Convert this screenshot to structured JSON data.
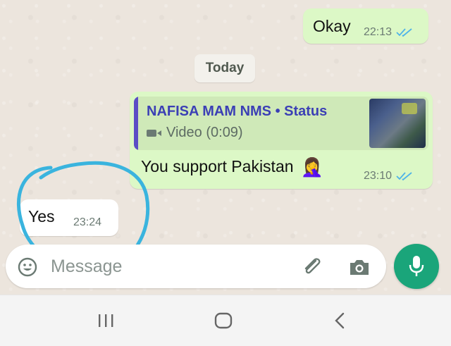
{
  "messages": [
    {
      "id": "okay",
      "direction": "outgoing",
      "text": "Okay",
      "time": "22:13",
      "status": "read"
    },
    {
      "id": "status_reply",
      "direction": "outgoing",
      "quote": {
        "title": "NAFISA MAM NMS • Status",
        "media_label": "Video (0:09)"
      },
      "text": "You support Pakistan",
      "emoji": "🤦‍♀️",
      "time": "23:10",
      "status": "read"
    },
    {
      "id": "yes",
      "direction": "incoming",
      "text": "Yes",
      "time": "23:24"
    }
  ],
  "date_divider": "Today",
  "composer": {
    "placeholder": "Message",
    "value": ""
  },
  "icons": {
    "emoji": "emoji-icon",
    "attach": "paperclip-icon",
    "camera": "camera-icon",
    "mic": "mic-icon",
    "ticks": "double-check-icon",
    "video": "video-camera-icon"
  },
  "colors": {
    "chat_background": "#ece5dd",
    "outgoing_bubble": "#dcf8c6",
    "incoming_bubble": "#ffffff",
    "quote_accent": "#5b4ec5",
    "read_ticks": "#4fb3e8",
    "mic_button": "#1aa57a",
    "annotation": "#3ab4de"
  },
  "annotation": {
    "shape": "hand-drawn circle",
    "target": "yes message"
  },
  "navbar": {
    "buttons": [
      "recent-apps",
      "home",
      "back"
    ]
  }
}
